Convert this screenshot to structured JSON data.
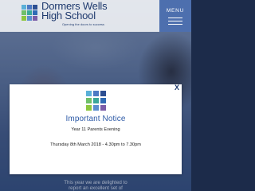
{
  "header": {
    "school_line1": "Dormers Wells",
    "school_line2": "High School",
    "tagline": "Opening the doors to success",
    "menu_label": "MENU"
  },
  "logo_colors": [
    "#5ab0d8",
    "#4c7ac4",
    "#2c4f92",
    "#6fbf6a",
    "#3aa89a",
    "#2f6bb5",
    "#8cc63f",
    "#5b8fd0",
    "#7a5ca8"
  ],
  "modal": {
    "close_label": "X",
    "title": "Important Notice",
    "subtitle": "Year 11 Parents Evening",
    "date_line": "Thursday 8th March 2018 - 4.30pm to 7.30pm"
  },
  "teaser": {
    "line1": "This year we are delighted to",
    "line2": "report an excellent set of"
  },
  "colors": {
    "brand": "#1f3a6e",
    "menu_bg": "#4d6fae",
    "notice_title": "#2d5aa6"
  }
}
